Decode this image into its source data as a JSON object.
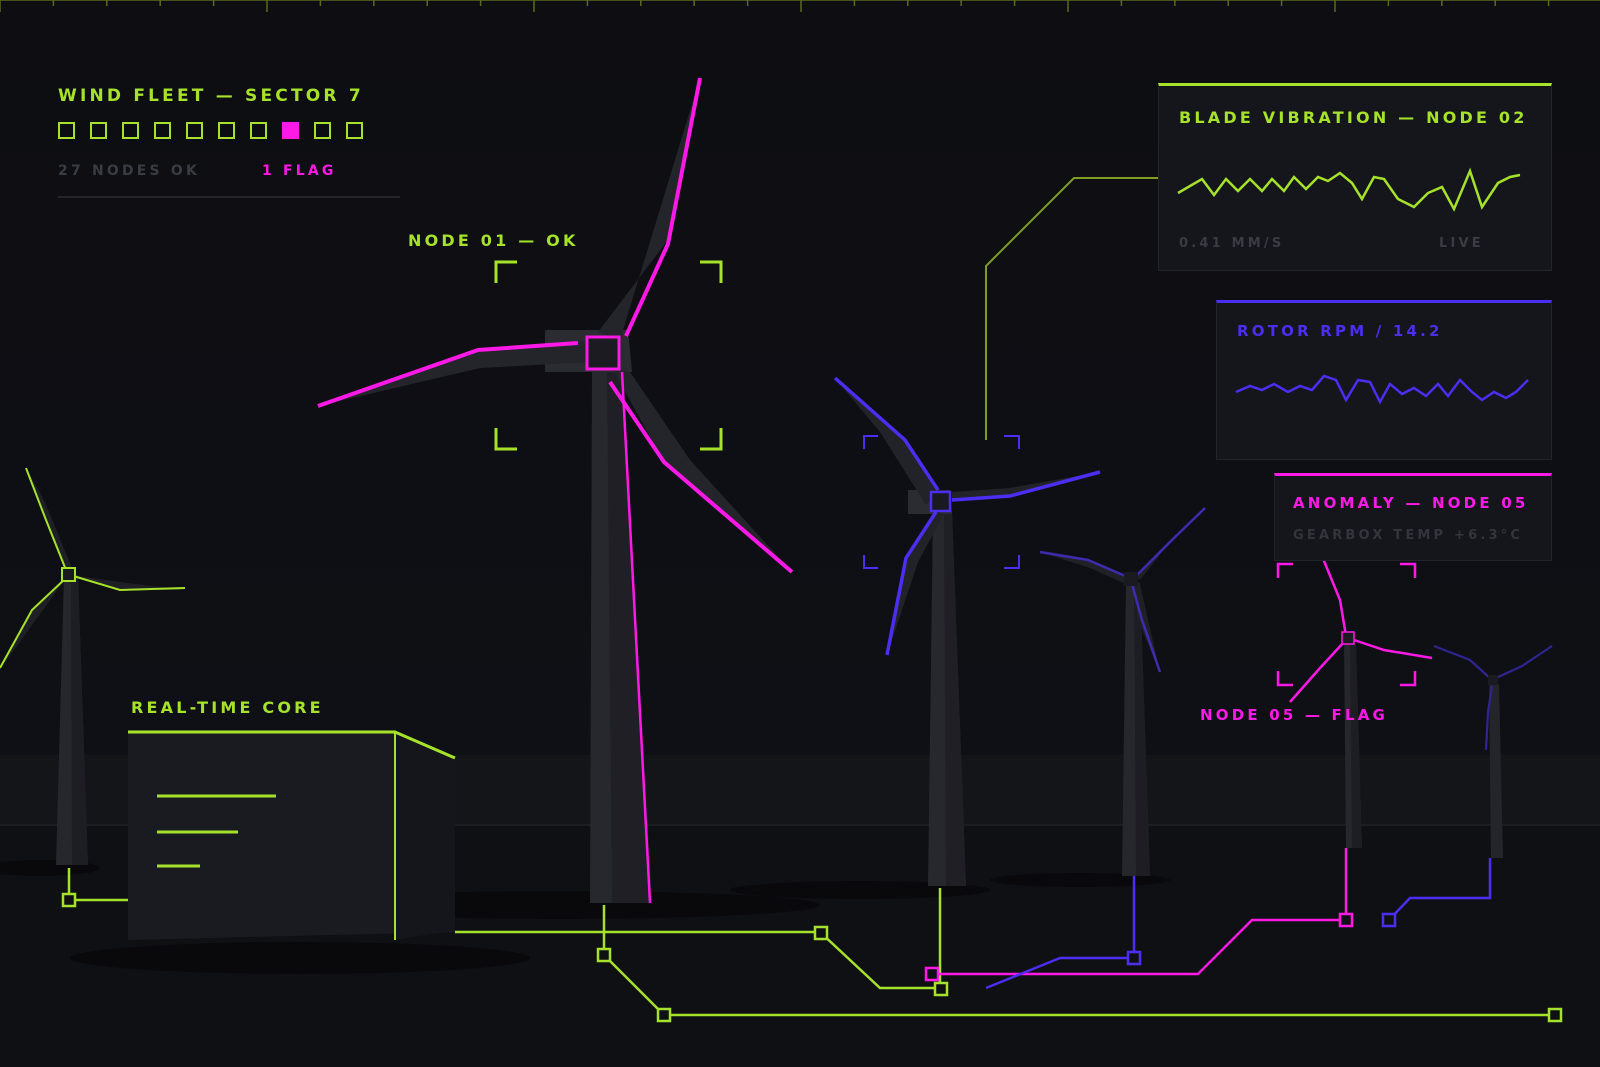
{
  "colors": {
    "background": "#0c0c11",
    "lime": "#a6e22a",
    "magenta": "#ff19e6",
    "violet": "#4a2ef2",
    "muted": "#3a3c44",
    "tower": "#2a2a31"
  },
  "fleet": {
    "title": "WIND FLEET — SECTOR 7",
    "nodes": [
      {
        "status": "ok"
      },
      {
        "status": "ok"
      },
      {
        "status": "ok"
      },
      {
        "status": "ok"
      },
      {
        "status": "ok"
      },
      {
        "status": "ok"
      },
      {
        "status": "ok"
      },
      {
        "status": "flag"
      },
      {
        "status": "ok"
      },
      {
        "status": "ok"
      }
    ],
    "ok_summary": "27 NODES OK",
    "flag_summary": "1 FLAG"
  },
  "labels": {
    "node01": "NODE 01 — OK",
    "node05": "NODE 05 — FLAG",
    "core": "REAL-TIME CORE"
  },
  "vibration": {
    "title": "BLADE VIBRATION — NODE 02",
    "reading": "0.41 MM/S",
    "status": "LIVE"
  },
  "rotor": {
    "title": "ROTOR RPM / 14.2"
  },
  "anomaly": {
    "title": "ANOMALY — NODE 05",
    "detail": "GEARBOX TEMP +6.3°C"
  }
}
